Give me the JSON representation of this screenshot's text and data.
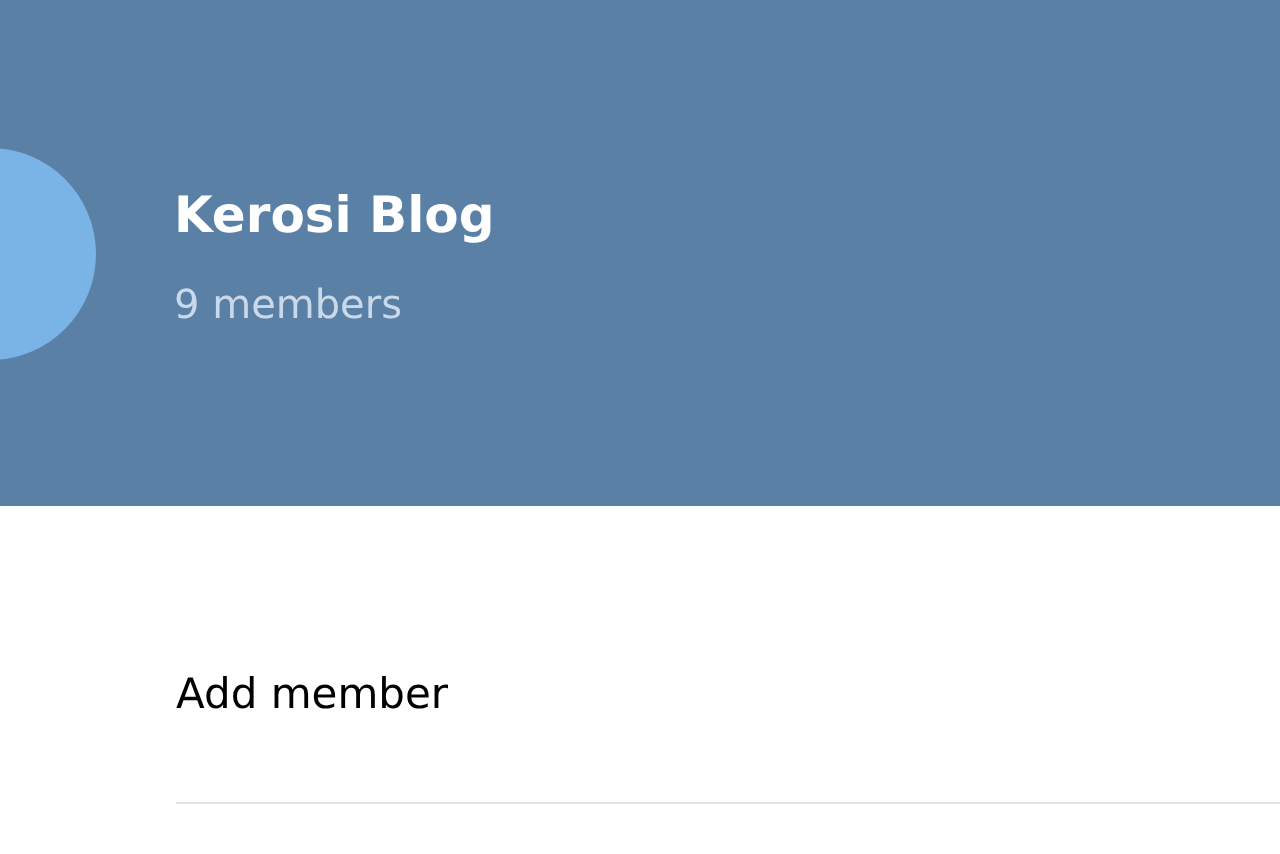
{
  "header": {
    "title": "Kerosi Blog",
    "subtitle": "9 members"
  },
  "actions": [
    {
      "label": "Add member"
    }
  ]
}
